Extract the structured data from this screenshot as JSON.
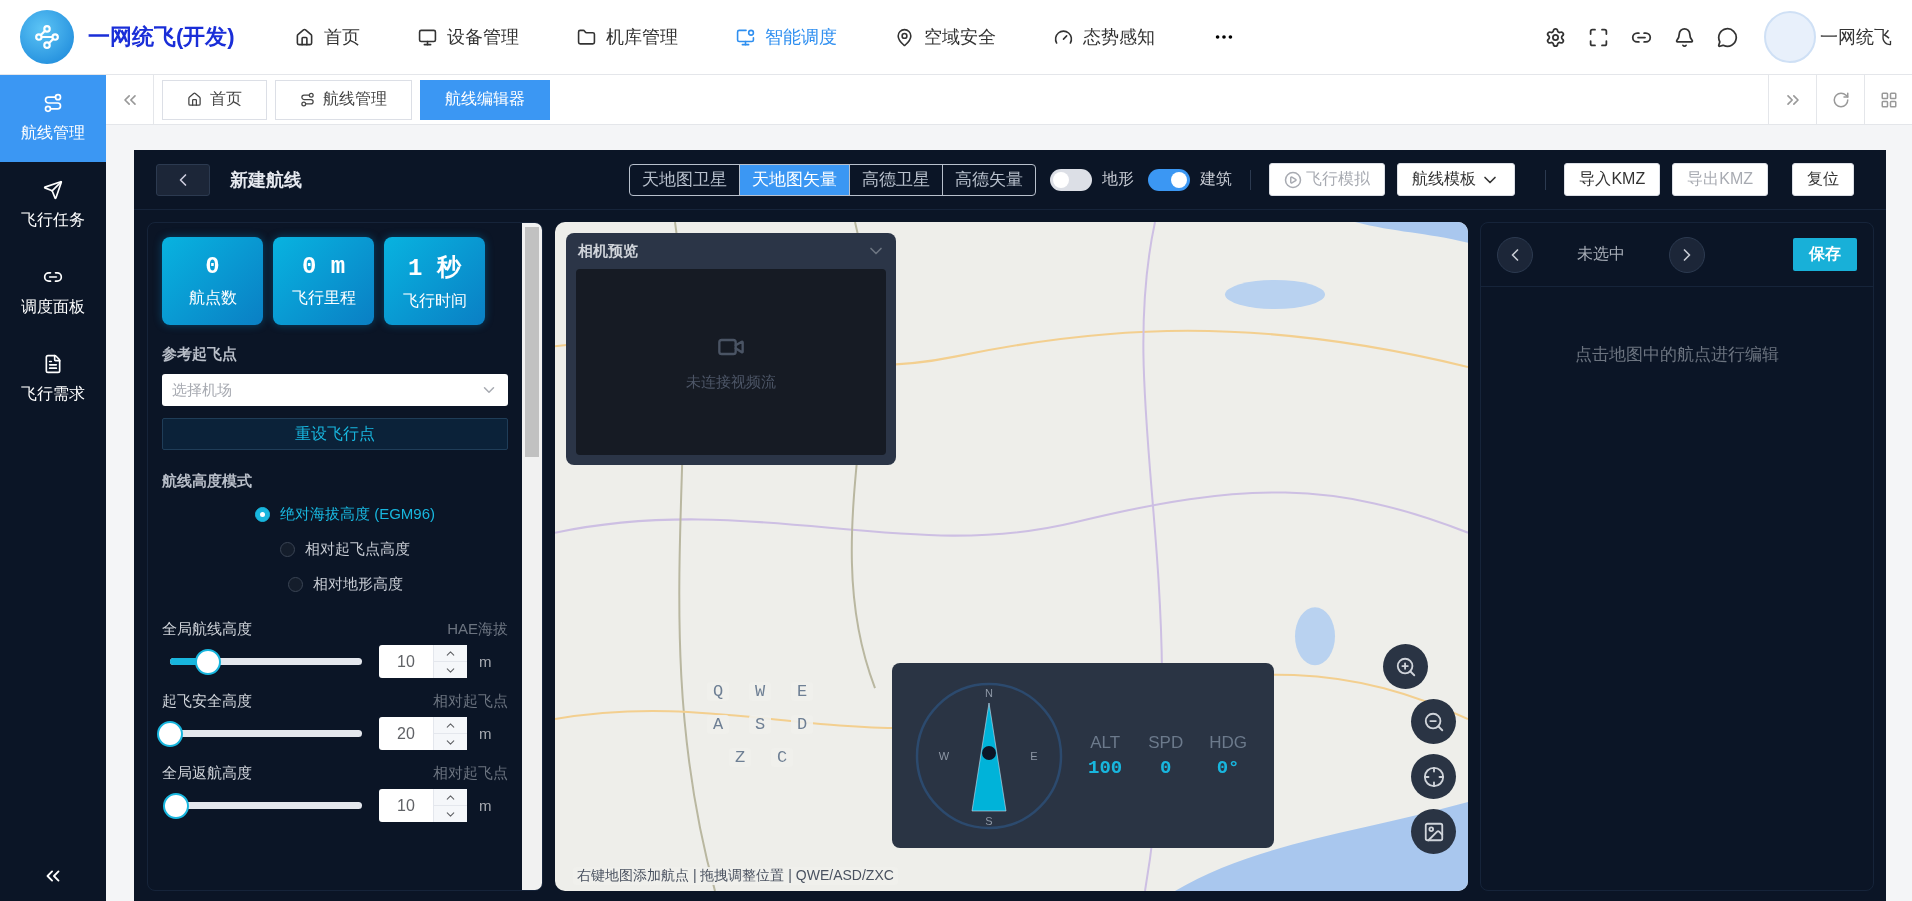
{
  "app": {
    "title": "一网统飞(开发)"
  },
  "nav": [
    {
      "label": "首页",
      "selected": false
    },
    {
      "label": "设备管理",
      "selected": false
    },
    {
      "label": "机库管理",
      "selected": false
    },
    {
      "label": "智能调度",
      "selected": true
    },
    {
      "label": "空域安全",
      "selected": false
    },
    {
      "label": "态势感知",
      "selected": false
    }
  ],
  "user": {
    "name": "一网统飞"
  },
  "sidebar": [
    {
      "label": "航线管理",
      "selected": true
    },
    {
      "label": "飞行任务",
      "selected": false
    },
    {
      "label": "调度面板",
      "selected": false
    },
    {
      "label": "飞行需求",
      "selected": false
    }
  ],
  "tabs": [
    {
      "label": "首页",
      "selected": false
    },
    {
      "label": "航线管理",
      "selected": false
    },
    {
      "label": "航线编辑器",
      "selected": true
    }
  ],
  "editor": {
    "title": "新建航线",
    "map_layers": [
      {
        "label": "天地图卫星",
        "selected": false
      },
      {
        "label": "天地图矢量",
        "selected": true
      },
      {
        "label": "高德卫星",
        "selected": false
      },
      {
        "label": "高德矢量",
        "selected": false
      }
    ],
    "toggles": [
      {
        "label": "地形",
        "on": false
      },
      {
        "label": "建筑",
        "on": true
      }
    ],
    "action_groups": [
      [
        {
          "label": "飞行模拟",
          "kind": "play",
          "disabled": true
        },
        {
          "label": "航线模板",
          "kind": "dropdown",
          "disabled": false
        }
      ],
      [
        {
          "label": "导入KMZ",
          "kind": "plain",
          "disabled": false
        },
        {
          "label": "导出KMZ",
          "kind": "plain",
          "disabled": true
        }
      ],
      [
        {
          "label": "复位",
          "kind": "plain",
          "disabled": false
        }
      ]
    ]
  },
  "stats": [
    {
      "value": "0",
      "label": "航点数"
    },
    {
      "value": "0 m",
      "label": "飞行里程"
    },
    {
      "value": "1 秒",
      "label": "飞行时间"
    }
  ],
  "takeoff": {
    "label": "参考起飞点",
    "placeholder": "选择机场",
    "button": "重设飞行点"
  },
  "height_mode": {
    "label": "航线高度模式",
    "options": [
      {
        "label": "绝对海拔高度 (EGM96)",
        "selected": true
      },
      {
        "label": "相对起飞点高度",
        "selected": false
      },
      {
        "label": "相对地形高度",
        "selected": false
      }
    ]
  },
  "altitudes": [
    {
      "label": "全局航线高度",
      "hint": "HAE海拔",
      "value": "10",
      "unit": "m",
      "level": 0.2
    },
    {
      "label": "起飞安全高度",
      "hint": "相对起飞点",
      "value": "20",
      "unit": "m",
      "level": 0
    },
    {
      "label": "全局返航高度",
      "hint": "相对起飞点",
      "value": "10",
      "unit": "m",
      "level": 0.03
    }
  ],
  "camera": {
    "title": "相机预览",
    "status": "未连接视频流"
  },
  "keys": [
    [
      "Q",
      "W",
      "E"
    ],
    [
      "A",
      "S",
      "D"
    ],
    [
      "Z",
      "C"
    ]
  ],
  "map_hint": "右键地图添加航点 | 拖拽调整位置 | QWE/ASD/ZXC",
  "compass": {
    "north": "N",
    "west": "W",
    "east": "E",
    "south": "S"
  },
  "telemetry": [
    {
      "label": "ALT",
      "value": "100"
    },
    {
      "label": "SPD",
      "value": "0"
    },
    {
      "label": "HDG",
      "value": "0°"
    }
  ],
  "waypoint_panel": {
    "status": "未选中",
    "save": "保存",
    "empty": "点击地图中的航点进行编辑"
  }
}
